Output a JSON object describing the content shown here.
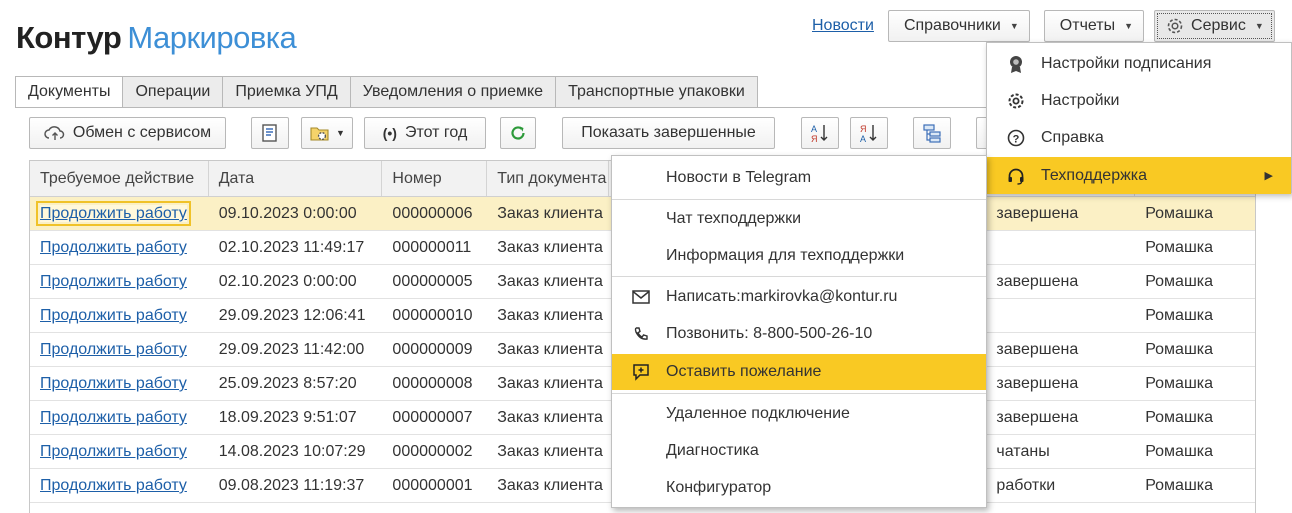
{
  "logo": {
    "brand": "Контур",
    "product": "Маркировка"
  },
  "top_nav": {
    "news": "Новости",
    "catalogs": "Справочники",
    "reports": "Отчеты",
    "service": "Сервис"
  },
  "tabs": [
    {
      "label": "Документы",
      "active": true
    },
    {
      "label": "Операции"
    },
    {
      "label": "Приемка УПД"
    },
    {
      "label": "Уведомления о приемке"
    },
    {
      "label": "Транспортные упаковки"
    }
  ],
  "toolbar": {
    "exchange": "Обмен с сервисом",
    "period": "Этот год",
    "show_completed": "Показать завершенные",
    "sort_asc": "А Я",
    "sort_desc": "Я А"
  },
  "table": {
    "headers": [
      "Требуемое действие",
      "Дата",
      "Номер",
      "Тип документа"
    ],
    "rows": [
      {
        "action": "Продолжить работу",
        "date": "09.10.2023 0:00:00",
        "number": "000000006",
        "type": "Заказ клиента",
        "status": "завершена",
        "org": "Ромашка"
      },
      {
        "action": "Продолжить работу",
        "date": "02.10.2023 11:49:17",
        "number": "000000011",
        "type": "Заказ клиента",
        "status": "",
        "org": "Ромашка"
      },
      {
        "action": "Продолжить работу",
        "date": "02.10.2023 0:00:00",
        "number": "000000005",
        "type": "Заказ клиента",
        "status": "завершена",
        "org": "Ромашка"
      },
      {
        "action": "Продолжить работу",
        "date": "29.09.2023 12:06:41",
        "number": "000000010",
        "type": "Заказ клиента",
        "status": "",
        "org": "Ромашка"
      },
      {
        "action": "Продолжить работу",
        "date": "29.09.2023 11:42:00",
        "number": "000000009",
        "type": "Заказ клиента",
        "status": "завершена",
        "org": "Ромашка"
      },
      {
        "action": "Продолжить работу",
        "date": "25.09.2023 8:57:20",
        "number": "000000008",
        "type": "Заказ клиента",
        "status": "завершена",
        "org": "Ромашка"
      },
      {
        "action": "Продолжить работу",
        "date": "18.09.2023 9:51:07",
        "number": "000000007",
        "type": "Заказ клиента",
        "status": "завершена",
        "org": "Ромашка"
      },
      {
        "action": "Продолжить работу",
        "date": "14.08.2023 10:07:29",
        "number": "000000002",
        "type": "Заказ клиента",
        "status": "чатаны",
        "org": "Ромашка"
      },
      {
        "action": "Продолжить работу",
        "date": "09.08.2023 11:19:37",
        "number": "000000001",
        "type": "Заказ клиента",
        "status": "работки",
        "org": "Ромашка"
      }
    ]
  },
  "service_menu": {
    "items": [
      {
        "label": "Настройки подписания",
        "icon": "seal-icon"
      },
      {
        "label": "Настройки",
        "icon": "gear-icon"
      },
      {
        "label": "Справка",
        "icon": "help-icon"
      },
      {
        "label": "Техподдержка",
        "icon": "headset-icon"
      }
    ]
  },
  "support_menu": {
    "items": [
      {
        "label": "Новости в Telegram"
      },
      {
        "label": "Чат техподдержки"
      },
      {
        "label": "Информация для техподдержки"
      },
      {
        "label": "Написать:markirovka@kontur.ru",
        "icon": "mail-icon"
      },
      {
        "label": "Позвонить: 8-800-500-26-10",
        "icon": "phone-icon"
      },
      {
        "label": "Оставить пожелание",
        "icon": "feedback-icon"
      },
      {
        "label": "Удаленное подключение"
      },
      {
        "label": "Диагностика"
      },
      {
        "label": "Конфигуратор"
      }
    ]
  },
  "colors": {
    "accent_yellow": "#f9c923",
    "selected_row": "#fbf0c5",
    "link": "#1d5fa8",
    "brand_blue": "#3d8fd6"
  }
}
